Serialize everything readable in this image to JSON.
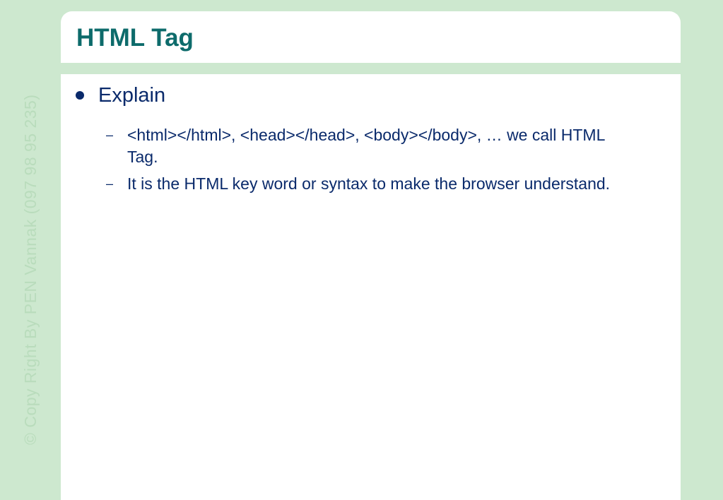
{
  "slide": {
    "title": "HTML Tag",
    "bullet": "Explain",
    "sub_bullets": [
      {
        "dash": "–",
        "text": "<html></html>, <head></head>, <body></body>, … we call HTML Tag."
      },
      {
        "dash": "–",
        "text": "It is the HTML key word or syntax to make the browser understand."
      }
    ],
    "watermark": "© Copy Right By PEN Vannak (097 98 95 235)"
  },
  "colors": {
    "background": "#cde8cf",
    "title": "#0d6b6b",
    "body_text": "#0a2a6b",
    "watermark": "#b9dcbc"
  }
}
